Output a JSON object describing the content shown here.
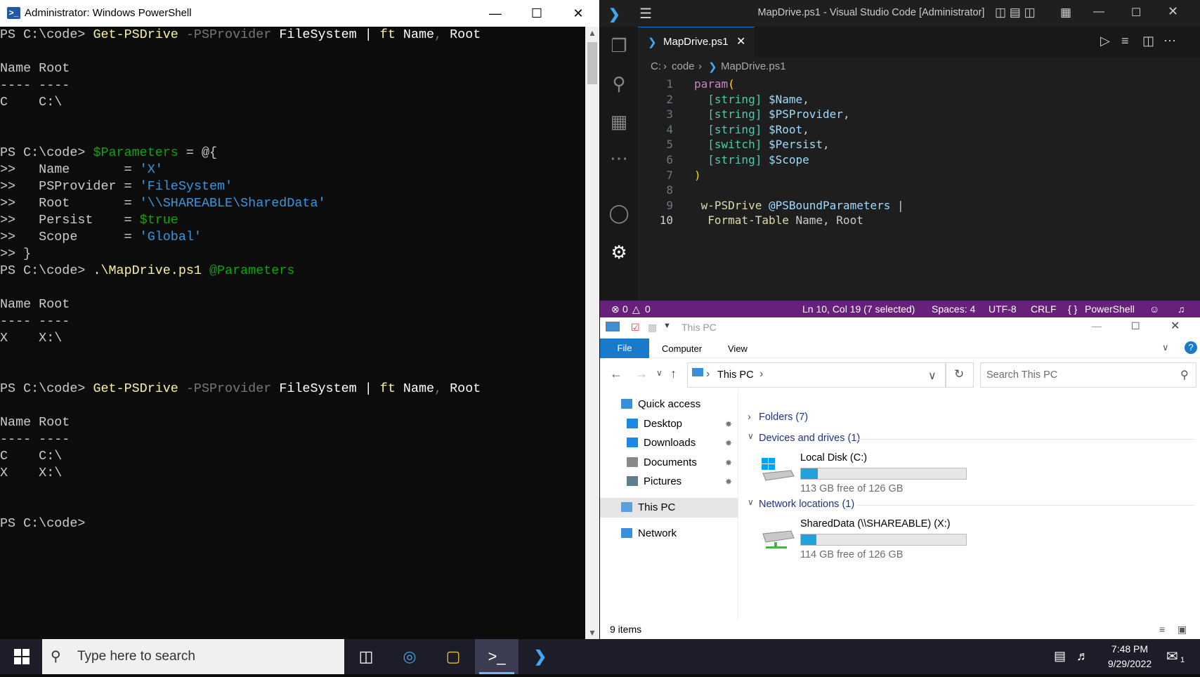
{
  "powershell": {
    "title": "Administrator: Windows PowerShell",
    "lines": [
      [
        {
          "t": "PS C:\\code> ",
          "c": "pl"
        },
        {
          "t": "Get-PSDrive",
          "c": "y"
        },
        {
          "t": " -PSProvider",
          "c": "g"
        },
        {
          "t": " FileSystem ",
          "c": "w"
        },
        {
          "t": "| ",
          "c": "w"
        },
        {
          "t": "ft",
          "c": "y"
        },
        {
          "t": " Name",
          "c": "w"
        },
        {
          "t": ",",
          "c": "g"
        },
        {
          "t": " Root",
          "c": "w"
        }
      ],
      [],
      [
        {
          "t": "Name Root",
          "c": "pl"
        }
      ],
      [
        {
          "t": "---- ----",
          "c": "pl"
        }
      ],
      [
        {
          "t": "C    C:\\",
          "c": "pl"
        }
      ],
      [],
      [],
      [
        {
          "t": "PS C:\\code> ",
          "c": "pl"
        },
        {
          "t": "$Parameters",
          "c": "gr"
        },
        {
          "t": " = @{",
          "c": "pl"
        }
      ],
      [
        {
          "t": ">>   Name       = ",
          "c": "pl"
        },
        {
          "t": "'X'",
          "c": "cy"
        }
      ],
      [
        {
          "t": ">>   PSProvider = ",
          "c": "pl"
        },
        {
          "t": "'FileSystem'",
          "c": "cy"
        }
      ],
      [
        {
          "t": ">>   Root       = ",
          "c": "pl"
        },
        {
          "t": "'\\\\SHAREABLE\\SharedData'",
          "c": "cy"
        }
      ],
      [
        {
          "t": ">>   Persist    = ",
          "c": "pl"
        },
        {
          "t": "$true",
          "c": "gr"
        }
      ],
      [
        {
          "t": ">>   Scope      = ",
          "c": "pl"
        },
        {
          "t": "'Global'",
          "c": "cy"
        }
      ],
      [
        {
          "t": ">> }",
          "c": "pl"
        }
      ],
      [
        {
          "t": "PS C:\\code> ",
          "c": "pl"
        },
        {
          "t": ".\\MapDrive.ps1",
          "c": "y"
        },
        {
          "t": " @Parameters",
          "c": "gr"
        }
      ],
      [],
      [
        {
          "t": "Name Root",
          "c": "pl"
        }
      ],
      [
        {
          "t": "---- ----",
          "c": "pl"
        }
      ],
      [
        {
          "t": "X    X:\\",
          "c": "pl"
        }
      ],
      [],
      [],
      [
        {
          "t": "PS C:\\code> ",
          "c": "pl"
        },
        {
          "t": "Get-PSDrive",
          "c": "y"
        },
        {
          "t": " -PSProvider",
          "c": "g"
        },
        {
          "t": " FileSystem ",
          "c": "w"
        },
        {
          "t": "| ",
          "c": "w"
        },
        {
          "t": "ft",
          "c": "y"
        },
        {
          "t": " Name",
          "c": "w"
        },
        {
          "t": ",",
          "c": "g"
        },
        {
          "t": " Root",
          "c": "w"
        }
      ],
      [],
      [
        {
          "t": "Name Root",
          "c": "pl"
        }
      ],
      [
        {
          "t": "---- ----",
          "c": "pl"
        }
      ],
      [
        {
          "t": "C    C:\\",
          "c": "pl"
        }
      ],
      [
        {
          "t": "X    X:\\",
          "c": "pl"
        }
      ],
      [],
      [],
      [
        {
          "t": "PS C:\\code>",
          "c": "pl"
        }
      ]
    ]
  },
  "vscode": {
    "title": "MapDrive.ps1 - Visual Studio Code [Administrator]",
    "tab_label": "MapDrive.ps1",
    "breadcrumb": [
      "C:",
      "code",
      "MapDrive.ps1"
    ],
    "code_lines": [
      {
        "n": "1",
        "parts": [
          {
            "t": "param",
            "c": "kw"
          },
          {
            "t": "(",
            "c": "br"
          }
        ]
      },
      {
        "n": "2",
        "parts": [
          {
            "t": "  [string] ",
            "c": "ty"
          },
          {
            "t": "$Name",
            "c": "va"
          },
          {
            "t": ",",
            "c": "pl"
          }
        ]
      },
      {
        "n": "3",
        "parts": [
          {
            "t": "  [string] ",
            "c": "ty"
          },
          {
            "t": "$PSProvider",
            "c": "va"
          },
          {
            "t": ",",
            "c": "pl"
          }
        ]
      },
      {
        "n": "4",
        "parts": [
          {
            "t": "  [string] ",
            "c": "ty"
          },
          {
            "t": "$Root",
            "c": "va"
          },
          {
            "t": ",",
            "c": "pl"
          }
        ]
      },
      {
        "n": "5",
        "parts": [
          {
            "t": "  [switch] ",
            "c": "ty"
          },
          {
            "t": "$Persist",
            "c": "va"
          },
          {
            "t": ",",
            "c": "pl"
          }
        ]
      },
      {
        "n": "6",
        "parts": [
          {
            "t": "  [string] ",
            "c": "ty"
          },
          {
            "t": "$Scope",
            "c": "va"
          }
        ]
      },
      {
        "n": "7",
        "parts": [
          {
            "t": ")",
            "c": "br"
          }
        ]
      },
      {
        "n": "8",
        "parts": []
      },
      {
        "n": "9",
        "parts": [
          {
            "t": " w-PSDrive ",
            "c": "fn"
          },
          {
            "t": "@PSBoundParameters",
            "c": "va"
          },
          {
            "t": " |",
            "c": "pl"
          }
        ]
      },
      {
        "n": "10",
        "parts": [
          {
            "t": "  Format-Table ",
            "c": "fn"
          },
          {
            "t": "Name, Root",
            "c": "pl"
          }
        ]
      }
    ],
    "status": {
      "errors": "0",
      "warnings": "0",
      "position": "Ln 10, Col 19 (7 selected)",
      "spaces": "Spaces: 4",
      "encoding": "UTF-8",
      "eol": "CRLF",
      "language": "PowerShell"
    }
  },
  "explorer": {
    "title": "This PC",
    "ribbon_tabs": [
      "File",
      "Computer",
      "View"
    ],
    "address": "This PC",
    "search_placeholder": "Search This PC",
    "nav": [
      {
        "label": "Quick access",
        "pinned": false
      },
      {
        "label": "Desktop",
        "pinned": true
      },
      {
        "label": "Downloads",
        "pinned": true
      },
      {
        "label": "Documents",
        "pinned": true
      },
      {
        "label": "Pictures",
        "pinned": true
      },
      {
        "label": "This PC",
        "pinned": false
      },
      {
        "label": "Network",
        "pinned": false
      }
    ],
    "groups": {
      "folders": "Folders (7)",
      "devices": "Devices and drives (1)",
      "network": "Network locations (1)"
    },
    "drives": [
      {
        "name": "Local Disk (C:)",
        "free": "113 GB free of 126 GB",
        "used_fraction": 0.1
      },
      {
        "name": "SharedData (\\\\SHAREABLE) (X:)",
        "free": "114 GB free of 126 GB",
        "used_fraction": 0.095
      }
    ],
    "status": "9 items"
  },
  "taskbar": {
    "search_placeholder": "Type here to search",
    "time": "7:48 PM",
    "date": "9/29/2022",
    "notifications": "1"
  }
}
